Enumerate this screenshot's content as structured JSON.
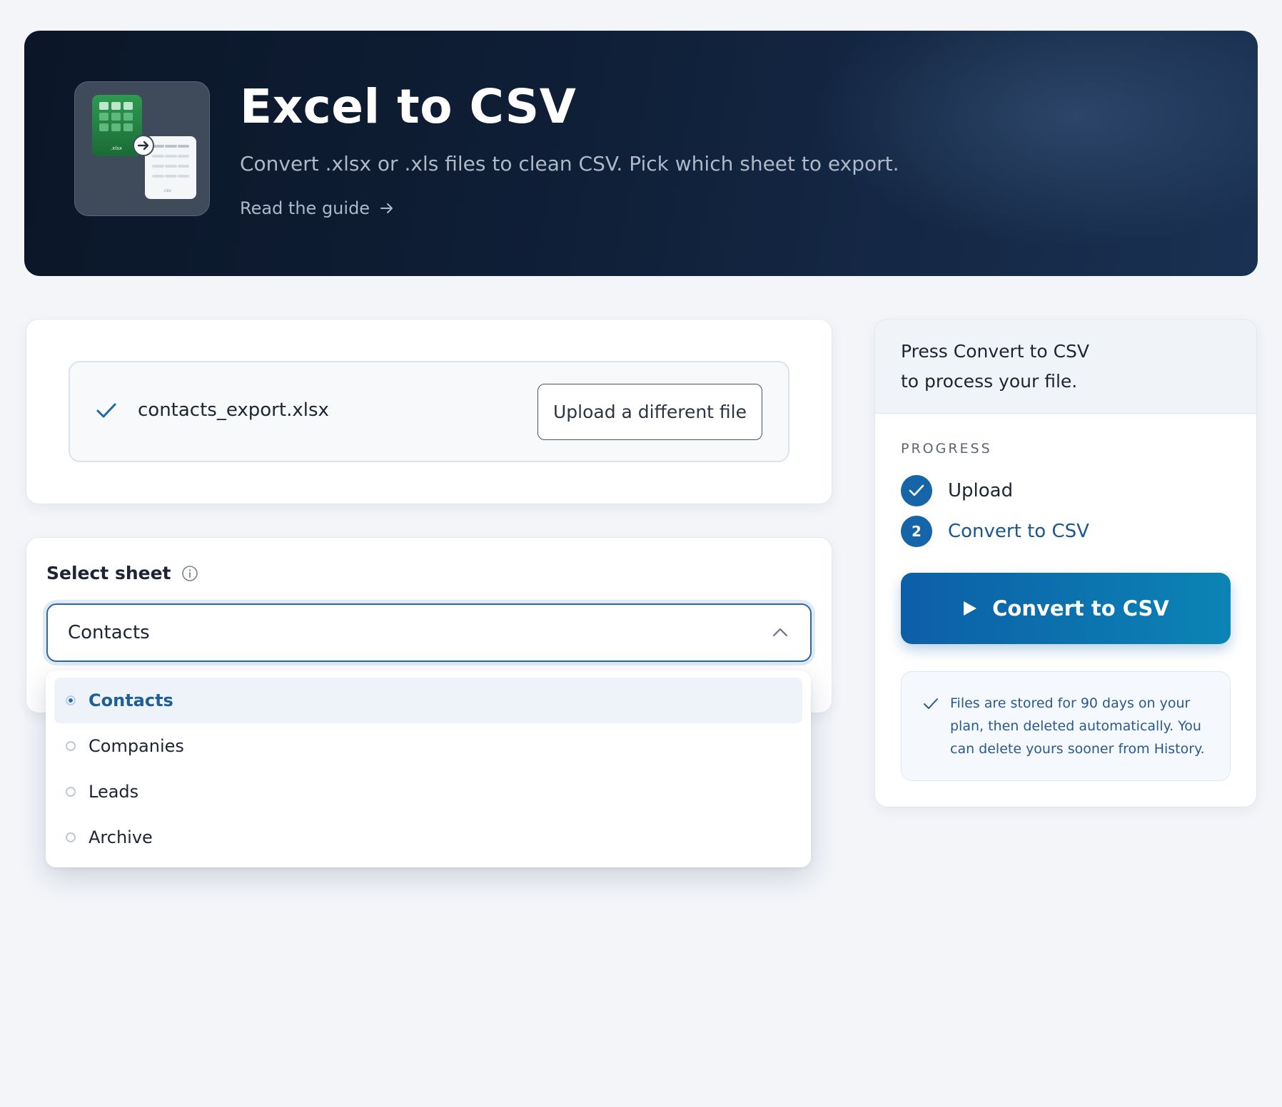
{
  "hero": {
    "title": "Excel to CSV",
    "subtitle": "Convert .xlsx or .xls files to clean CSV. Pick which sheet to export.",
    "guide_link": "Read the guide",
    "icon_labels": {
      "source": ".xlsx",
      "target": ".csv"
    }
  },
  "upload": {
    "file_name": "contacts_export.xlsx",
    "change_button": "Upload a different file"
  },
  "sheet": {
    "label": "Select sheet",
    "selected": "Contacts",
    "options": [
      {
        "label": "Contacts",
        "selected": true
      },
      {
        "label": "Companies",
        "selected": false
      },
      {
        "label": "Leads",
        "selected": false
      },
      {
        "label": "Archive",
        "selected": false
      }
    ]
  },
  "sidebar": {
    "hint_line1": "Press Convert to CSV",
    "hint_line2": "to process your file.",
    "progress_label": "PROGRESS",
    "steps": [
      {
        "number": "",
        "label": "Upload",
        "status": "done"
      },
      {
        "number": "2",
        "label": "Convert to CSV",
        "status": "current"
      }
    ],
    "convert_button": "Convert to CSV",
    "info": "Files are stored for 90 days on your plan, then deleted automatically. You can delete yours sooner from History."
  },
  "colors": {
    "hero_bg": "#0f1f37",
    "accent": "#1565a8",
    "button_gradient_start": "#0d5ea8",
    "button_gradient_end": "#0b84b4",
    "info_text": "#2a5a8c"
  },
  "icons": [
    "excel-to-csv-app-icon",
    "arrow-right-icon",
    "check-icon",
    "info-icon",
    "chevron-up-icon",
    "play-icon"
  ]
}
